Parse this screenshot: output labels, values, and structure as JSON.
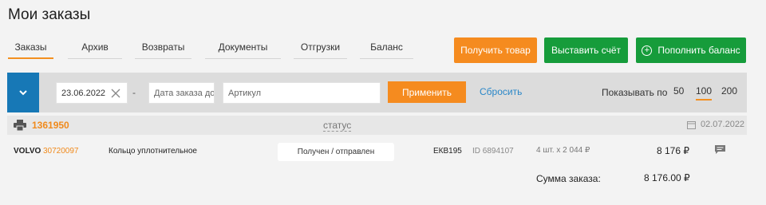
{
  "page": {
    "title": "Мои заказы"
  },
  "tabs": [
    {
      "label": "Заказы",
      "active": true
    },
    {
      "label": "Архив"
    },
    {
      "label": "Возвраты"
    },
    {
      "label": "Документы"
    },
    {
      "label": "Отгрузки"
    },
    {
      "label": "Баланс"
    }
  ],
  "actions": {
    "get_goods": "Получить товар",
    "invoice": "Выставить счёт",
    "top_up": "Пополнить баланс"
  },
  "filters": {
    "date_from": "23.06.2022",
    "date_separator": "-",
    "date_to_placeholder": "Дата заказа до",
    "article_placeholder": "Артикул",
    "apply": "Применить",
    "reset": "Сбросить",
    "show_by_label": "Показывать по",
    "page_sizes": [
      "50",
      "100",
      "200"
    ],
    "page_size_selected": "100"
  },
  "order": {
    "number": "1361950",
    "status_label": "статус",
    "date": "02.07.2022",
    "items": [
      {
        "brand": "VOLVO",
        "part_no": "30720097",
        "name": "Кольцо уплотнительное",
        "status": "Получен / отправлен",
        "warehouse": "ЕКВ195",
        "id": "ID 6894107",
        "qty": "4 шт. х 2 044 ₽",
        "price": "8 176 ₽"
      }
    ],
    "total_label": "Сумма заказа:",
    "total_value": "8 176.00 ₽"
  },
  "colors": {
    "accent_orange": "#f58b1f",
    "accent_green": "#169c3b",
    "toggle_blue": "#1778b6",
    "link_blue": "#2a87c8"
  }
}
